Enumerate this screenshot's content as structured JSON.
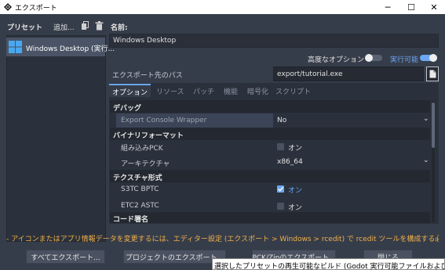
{
  "window": {
    "title": "エクスポート",
    "minimize": "─",
    "maximize": "☐",
    "close": "✕"
  },
  "left": {
    "presets_label": "プリセット",
    "add_label": "追加...",
    "items": [
      {
        "label": "Windows Desktop (実行..."
      }
    ]
  },
  "right": {
    "name_label": "名前:",
    "name_value": "Windows Desktop",
    "advanced_label": "高度なオプション",
    "runnable_label": "実行可能",
    "export_path_label": "エクスポート先のパス",
    "export_path_value": "export/tutorial.exe",
    "tabs": [
      "オプション",
      "リソース",
      "パッチ",
      "機能",
      "暗号化",
      "スクリプト"
    ],
    "sections": {
      "debug": "デバッグ",
      "binary_format": "バイナリフォーマット",
      "texture_format": "テクスチャ形式",
      "code_signing": "コード署名"
    },
    "properties": {
      "console_wrapper": {
        "label": "Export Console Wrapper",
        "value": "No"
      },
      "embed_pck": {
        "label": "組み込みPCK",
        "value": "オン",
        "checked": false
      },
      "architecture": {
        "label": "アーキテクチャ",
        "value": "x86_64"
      },
      "s3tc_bptc": {
        "label": "S3TC BPTC",
        "value": "オン",
        "checked": true
      },
      "etc2_astc": {
        "label": "ETC2 ASTC",
        "value": "オン",
        "checked": false
      }
    }
  },
  "warning": "- アイコンまたはアプリ情報データを変更するには、エディター設定 (エクスポート > Windows > rcedit) で rcedit ツールを構成する必要があり...",
  "buttons": {
    "export_all": "すべてエクスポート...",
    "export_project": "プロジェクトのエクスポート...",
    "export_pck": "PCK/Zipのエクスポート...",
    "close": "閉じる"
  },
  "tooltip": "選択したプリセットの再生可能なビルド (Godot 実行可能ファイルおよびプロジェクト",
  "colors": {
    "accent": "#6ca7f5",
    "warning": "#f0b04a",
    "background": "#363d4a",
    "panel": "#2b313c"
  }
}
